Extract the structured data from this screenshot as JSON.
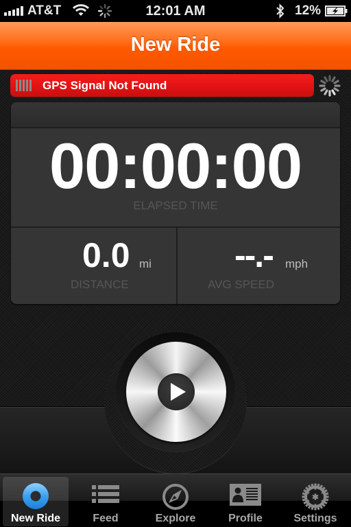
{
  "status_bar": {
    "carrier": "AT&T",
    "time": "12:01 AM",
    "battery_percent": "12%",
    "icons": [
      "signal-icon",
      "wifi-icon",
      "activity-spinner-icon",
      "bluetooth-icon",
      "battery-charging-icon"
    ]
  },
  "nav": {
    "title": "New Ride"
  },
  "gps": {
    "status_text": "GPS Signal Not Found",
    "color": "#e41414"
  },
  "stats": {
    "elapsed_time": {
      "value": "00:00:00",
      "label": "ELAPSED TIME"
    },
    "distance": {
      "value": "0.0",
      "unit": "mi",
      "label": "DISTANCE"
    },
    "avg_speed": {
      "value": "--.-",
      "unit": "mph",
      "label": "AVG SPEED"
    }
  },
  "play_button": {
    "icon": "play-icon"
  },
  "tabs": [
    {
      "label": "New Ride",
      "icon": "new-ride-icon",
      "active": true
    },
    {
      "label": "Feed",
      "icon": "feed-list-icon",
      "active": false
    },
    {
      "label": "Explore",
      "icon": "compass-icon",
      "active": false
    },
    {
      "label": "Profile",
      "icon": "profile-card-icon",
      "active": false
    },
    {
      "label": "Settings",
      "icon": "gear-icon",
      "active": false
    }
  ],
  "colors": {
    "nav_orange": "#ff5a00",
    "gps_red": "#e41414",
    "active_tab_blue": "#3aa0f0"
  }
}
